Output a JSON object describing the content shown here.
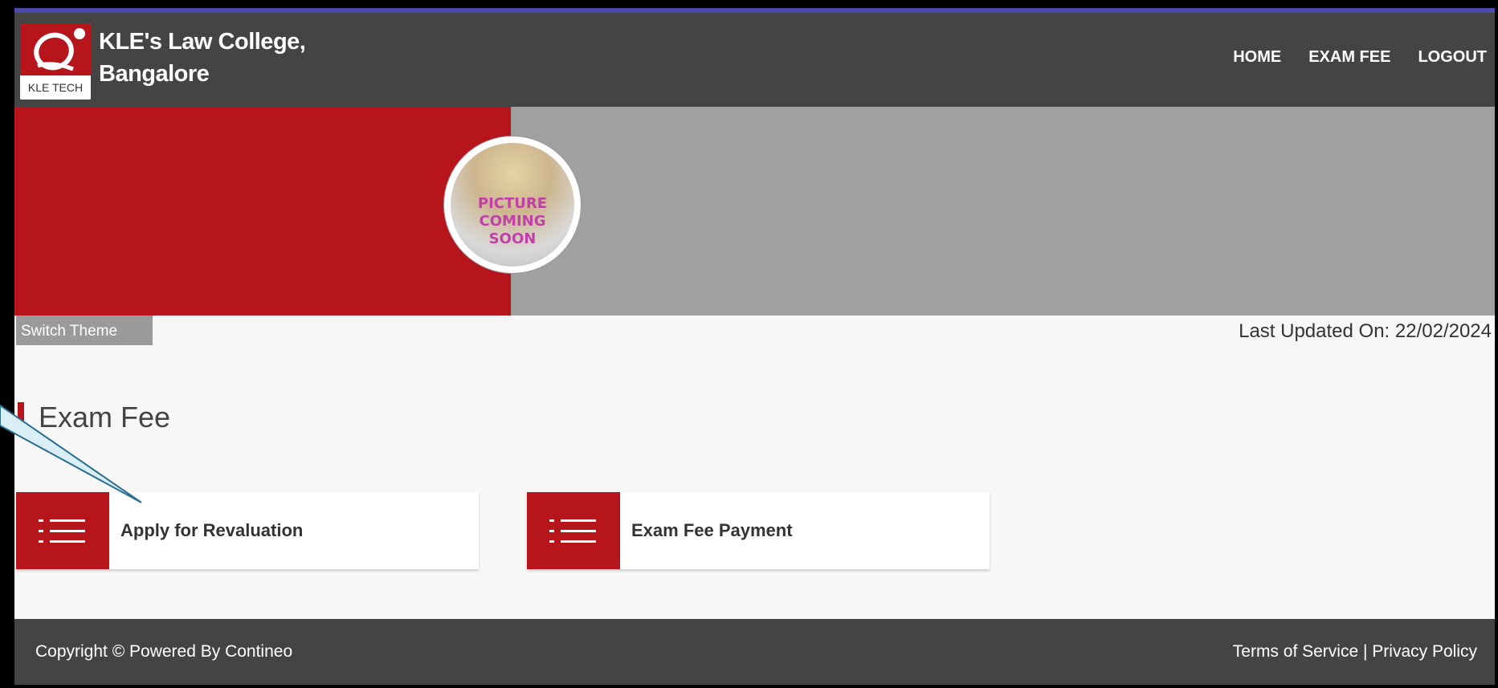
{
  "header": {
    "logo_tag": "KLE TECH",
    "college_name_line1": "KLE's Law College,",
    "college_name_line2": "Bangalore",
    "nav": [
      "HOME",
      "EXAM FEE",
      "LOGOUT"
    ]
  },
  "banner": {
    "avatar_text_line1": "PICTURE",
    "avatar_text_line2": "COMING",
    "avatar_text_line3": "SOON"
  },
  "toolbar": {
    "switch_theme_label": "Switch Theme",
    "last_updated": "Last Updated On: 22/02/2024"
  },
  "section": {
    "title": "Exam Fee",
    "cards": [
      {
        "label": "Apply for Revaluation",
        "icon": "list-icon"
      },
      {
        "label": "Exam Fee Payment",
        "icon": "list-icon"
      }
    ]
  },
  "footer": {
    "copyright": "Copyright © Powered By Contineo",
    "terms": "Terms of Service",
    "separator": "|",
    "privacy": "Privacy Policy"
  },
  "colors": {
    "brand_red": "#b5151b",
    "header_grey": "#444444",
    "banner_grey": "#a0a0a0",
    "content_bg": "#f7f7f7"
  }
}
